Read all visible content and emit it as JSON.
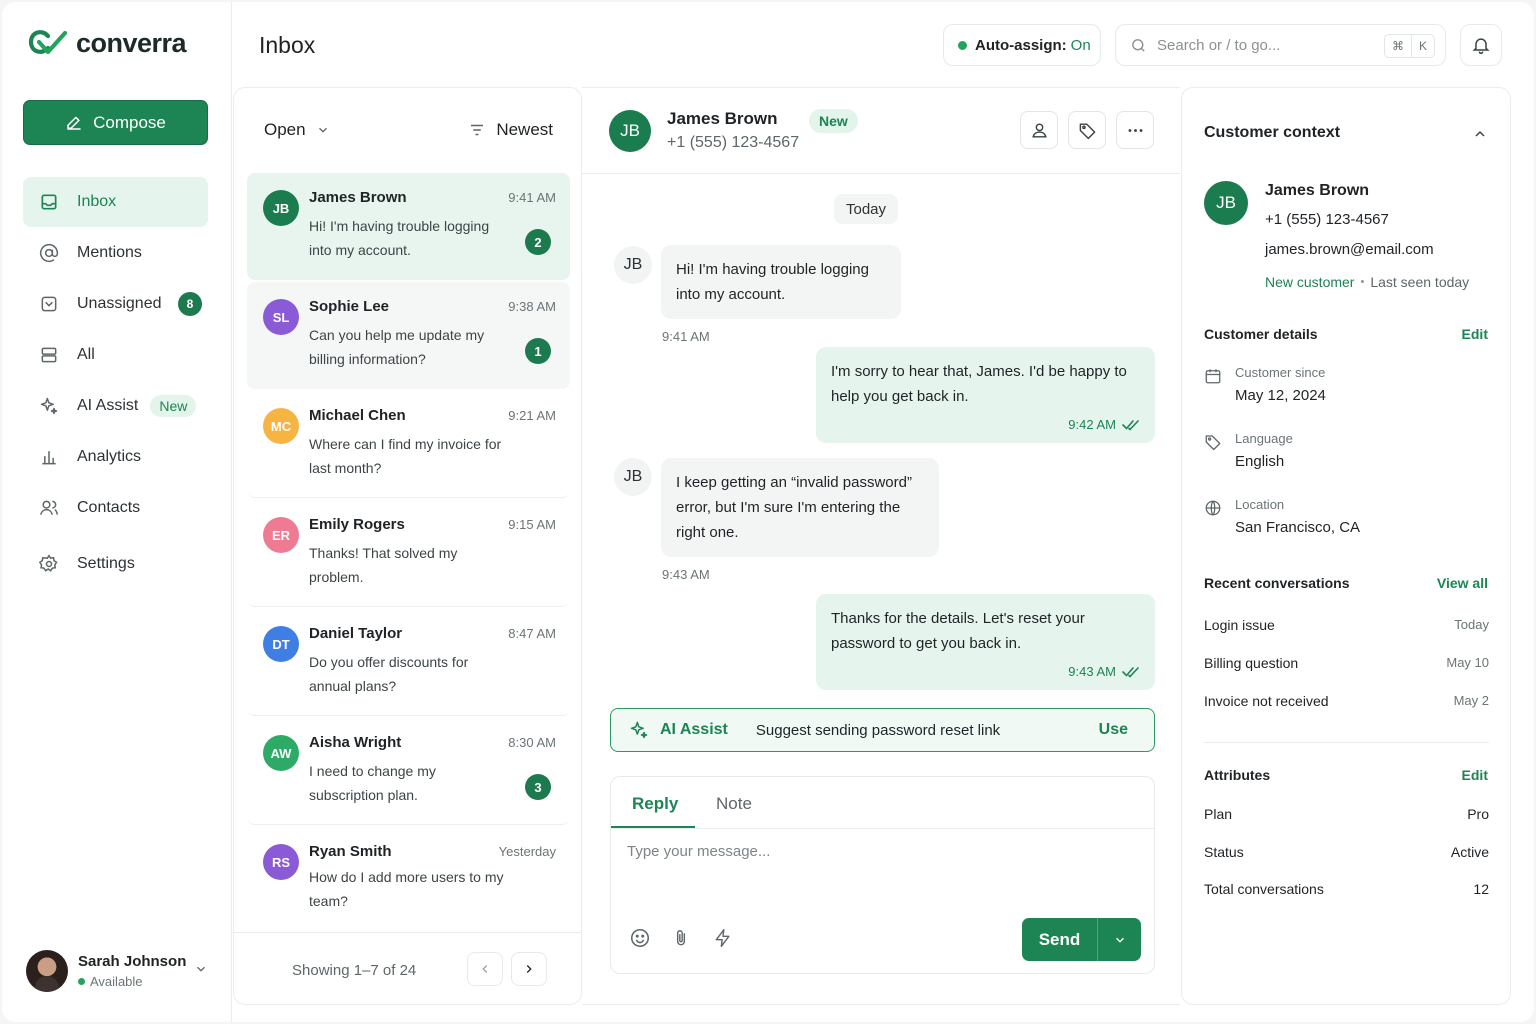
{
  "brand": {
    "name": "converra",
    "accent": "#1d8454"
  },
  "sidebar": {
    "compose_label": "Compose",
    "items": [
      {
        "label": "Inbox",
        "icon": "inbox-icon",
        "active": true
      },
      {
        "label": "Mentions",
        "icon": "at-sign-icon"
      },
      {
        "label": "Unassigned",
        "icon": "unassigned-icon",
        "badge": "8"
      },
      {
        "label": "All",
        "icon": "stack-icon"
      },
      {
        "label": "AI Assist",
        "icon": "sparkle-icon",
        "pill": "New"
      },
      {
        "label": "Analytics",
        "icon": "bar-chart-icon"
      },
      {
        "label": "Contacts",
        "icon": "contacts-icon"
      },
      {
        "label": "Settings",
        "icon": "gear-icon"
      }
    ],
    "user": {
      "name": "Sarah Johnson",
      "status": "Available"
    }
  },
  "header": {
    "title": "Inbox",
    "auto_assign_label": "Auto-assign:",
    "auto_assign_value": "On",
    "search_placeholder": "Search or / to go...",
    "kbd_mod": "⌘",
    "kbd_key": "K"
  },
  "list": {
    "filter_label": "Open",
    "sort_label": "Newest",
    "conversations": [
      {
        "initials": "JB",
        "name": "James Brown",
        "time": "9:41 AM",
        "preview": "Hi! I'm having trouble logging into my account.",
        "badge": "2",
        "color": "#1b7d4f"
      },
      {
        "initials": "SL",
        "name": "Sophie Lee",
        "time": "9:38 AM",
        "preview": "Can you help me update my billing information?",
        "badge": "1",
        "color": "#8b5ad6"
      },
      {
        "initials": "MC",
        "name": "Michael Chen",
        "time": "9:21 AM",
        "preview": "Where can I find my invoice for last month?",
        "badge": "",
        "color": "#f6b443"
      },
      {
        "initials": "ER",
        "name": "Emily Rogers",
        "time": "9:15 AM",
        "preview": "Thanks! That solved my problem.",
        "badge": "",
        "color": "#ef7b93"
      },
      {
        "initials": "DT",
        "name": "Daniel Taylor",
        "time": "8:47 AM",
        "preview": "Do you offer discounts for annual plans?",
        "badge": "",
        "color": "#3f7fe4"
      },
      {
        "initials": "AW",
        "name": "Aisha Wright",
        "time": "8:30 AM",
        "preview": "I need to change my subscription plan.",
        "badge": "3",
        "color": "#2eaa67"
      },
      {
        "initials": "RS",
        "name": "Ryan Smith",
        "time": "Yesterday",
        "preview": "How do I add more users to my team?",
        "badge": "",
        "color": "#8b5ad6"
      }
    ],
    "showing": "Showing 1–7 of 24"
  },
  "chat": {
    "initials": "JB",
    "name": "James Brown",
    "phone": "+1 (555) 123-4567",
    "status_pill": "New",
    "day": "Today",
    "messages": [
      {
        "dir": "in",
        "text": "Hi! I'm having trouble logging into my account.",
        "time": "9:41 AM"
      },
      {
        "dir": "out",
        "text": "I'm sorry to hear that, James. I'd be happy to help you get back in.",
        "time": "9:42 AM"
      },
      {
        "dir": "in",
        "text": "I keep getting an “invalid password” error, but I'm sure I'm entering the right one.",
        "time": "9:43 AM"
      },
      {
        "dir": "out",
        "text": "Thanks for the details. Let's reset your password to get you back in.",
        "time": "9:43 AM"
      }
    ],
    "ai": {
      "label": "AI Assist",
      "suggestion": "Suggest sending password reset link",
      "action": "Use"
    },
    "composer": {
      "tab_reply": "Reply",
      "tab_note": "Note",
      "placeholder": "Type your message...",
      "send_label": "Send"
    }
  },
  "context": {
    "title": "Customer context",
    "initials": "JB",
    "name": "James Brown",
    "phone": "+1 (555) 123-4567",
    "email": "james.brown@email.com",
    "tag": "New customer",
    "last_seen": "Last seen today",
    "details_title": "Customer details",
    "details_edit": "Edit",
    "details": [
      {
        "icon": "calendar-icon",
        "label": "Customer since",
        "value": "May 12, 2024"
      },
      {
        "icon": "tag-icon",
        "label": "Language",
        "value": "English"
      },
      {
        "icon": "globe-icon",
        "label": "Location",
        "value": "San Francisco, CA"
      }
    ],
    "recent_title": "Recent conversations",
    "recent_link": "View all",
    "recent": [
      {
        "name": "Login issue",
        "date": "Today"
      },
      {
        "name": "Billing question",
        "date": "May 10"
      },
      {
        "name": "Invoice not received",
        "date": "May 2"
      }
    ],
    "attributes_title": "Attributes",
    "attributes_edit": "Edit",
    "attributes": [
      {
        "label": "Plan",
        "value": "Pro"
      },
      {
        "label": "Status",
        "value": "Active"
      },
      {
        "label": "Total conversations",
        "value": "12"
      }
    ]
  }
}
